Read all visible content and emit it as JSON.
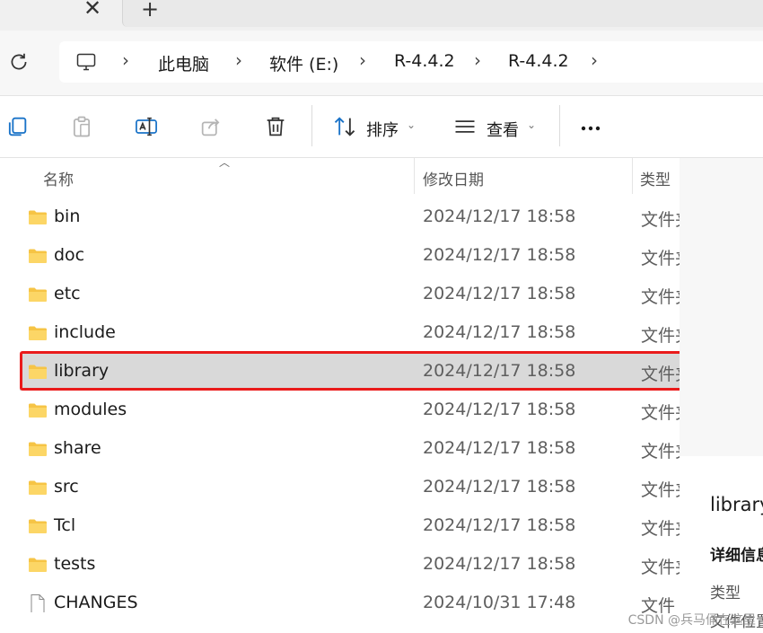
{
  "tabs": {
    "close_glyph": "✕",
    "new_glyph": "+"
  },
  "breadcrumb": [
    "此电脑",
    "软件 (E:)",
    "R-4.4.2",
    "R-4.4.2"
  ],
  "breadcrumb_separator": "›",
  "toolbar": {
    "sort_label": "排序",
    "view_label": "查看",
    "more_glyph": "•••"
  },
  "columns": {
    "name": "名称",
    "modified": "修改日期",
    "type": "类型"
  },
  "files": [
    {
      "name": "bin",
      "date": "2024/12/17 18:58",
      "type": "文件夹",
      "kind": "folder"
    },
    {
      "name": "doc",
      "date": "2024/12/17 18:58",
      "type": "文件夹",
      "kind": "folder"
    },
    {
      "name": "etc",
      "date": "2024/12/17 18:58",
      "type": "文件夹",
      "kind": "folder"
    },
    {
      "name": "include",
      "date": "2024/12/17 18:58",
      "type": "文件夹",
      "kind": "folder"
    },
    {
      "name": "library",
      "date": "2024/12/17 18:58",
      "type": "文件夹",
      "kind": "folder",
      "selected": true
    },
    {
      "name": "modules",
      "date": "2024/12/17 18:58",
      "type": "文件夹",
      "kind": "folder"
    },
    {
      "name": "share",
      "date": "2024/12/17 18:58",
      "type": "文件夹",
      "kind": "folder"
    },
    {
      "name": "src",
      "date": "2024/12/17 18:58",
      "type": "文件夹",
      "kind": "folder"
    },
    {
      "name": "Tcl",
      "date": "2024/12/17 18:58",
      "type": "文件夹",
      "kind": "folder"
    },
    {
      "name": "tests",
      "date": "2024/12/17 18:58",
      "type": "文件夹",
      "kind": "folder"
    },
    {
      "name": "CHANGES",
      "date": "2024/10/31 17:48",
      "type": "文件",
      "kind": "file"
    }
  ],
  "details": {
    "title": "library",
    "subtitle": "详细信息",
    "line1": "类型",
    "line2": "文件位置"
  },
  "watermark": "CSDN @兵马俑在这里",
  "colors": {
    "highlight": "#ea1b1b",
    "selected_row": "#d9d9d9",
    "folder": "#f6c445"
  }
}
